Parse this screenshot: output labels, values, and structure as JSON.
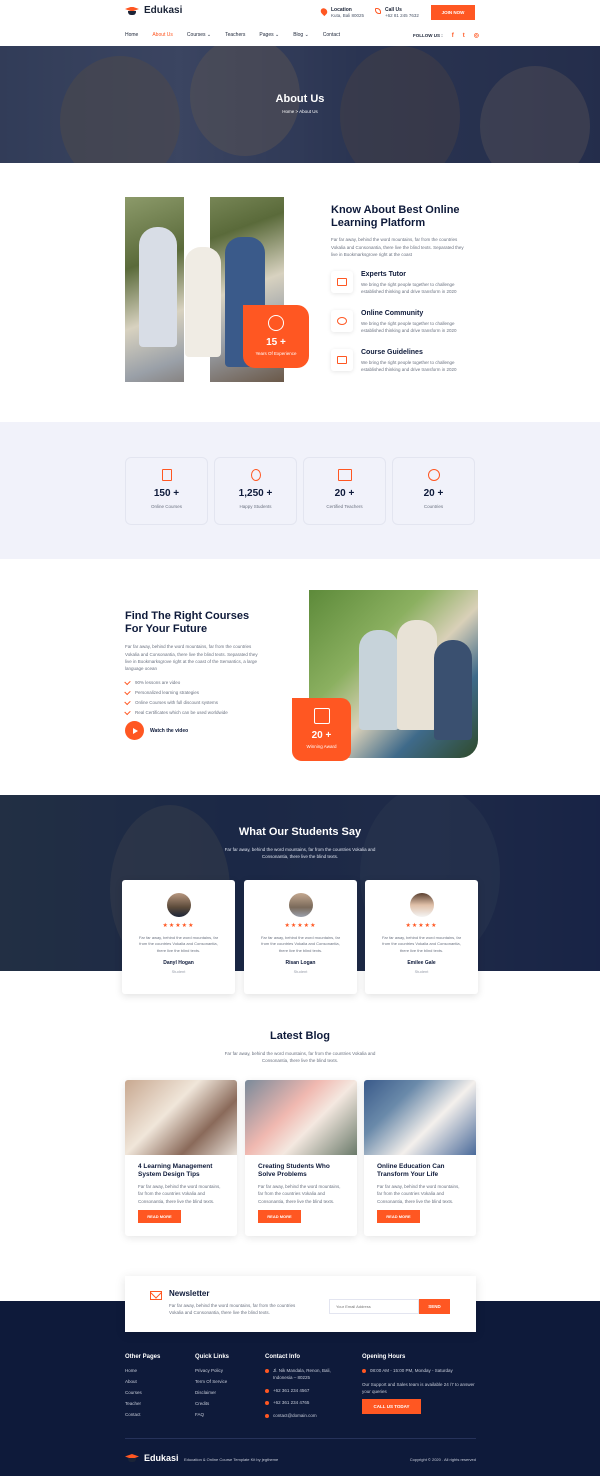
{
  "header": {
    "brand": "Edukasi",
    "location_label": "Location",
    "location_value": "Kuta, Bali 80025",
    "call_label": "Call Us",
    "call_value": "+62 81 245 7632",
    "join_button": "JOIN NOW",
    "follow_label": "FOLLOW US :",
    "nav": [
      {
        "label": "Home"
      },
      {
        "label": "About Us"
      },
      {
        "label": "Courses ⌄"
      },
      {
        "label": "Teachers"
      },
      {
        "label": "Pages ⌄"
      },
      {
        "label": "Blog ⌄"
      },
      {
        "label": "Contact"
      }
    ],
    "social_icons": [
      "facebook-icon",
      "twitter-icon",
      "instagram-icon"
    ]
  },
  "hero": {
    "title": "About Us",
    "breadcrumb": "Home  >  About Us"
  },
  "about": {
    "badge_number": "15 +",
    "badge_label": "Years Of Experience",
    "title_line1": "Know About Best Online",
    "title_line2": "Learning Platform",
    "text": "Far far away, behind the word mountains, far from the countries Vokalia and Consonantia, there live the blind texts. Separated they live in Bookmarksgrove right at the coast",
    "features": [
      {
        "title": "Experts Tutor",
        "text": "We bring the right people together to challenge established thinking and drive transform in 2020"
      },
      {
        "title": "Online Community",
        "text": "We bring the right people together to challenge established thinking and drive transform in 2020"
      },
      {
        "title": "Course Guidelines",
        "text": "We bring the right people together to challenge established thinking and drive transform in 2020"
      }
    ]
  },
  "stats": [
    {
      "number": "150 +",
      "label": "Online Courses",
      "icon": "book-icon"
    },
    {
      "number": "1,250 +",
      "label": "Happy Students",
      "icon": "student-icon"
    },
    {
      "number": "20 +",
      "label": "Certified Teachers",
      "icon": "teachers-icon"
    },
    {
      "number": "20 +",
      "label": "Countries",
      "icon": "globe-icon"
    }
  ],
  "courses": {
    "title_line1": "Find The Right Courses",
    "title_line2": "For Your Future",
    "text": "Far far away, behind the word mountains, far from the countries Vokalia and Consonantia, there live the blind texts. Separated they live in Bookmarksgrove right at the coast of the Semantics, a large language ocean",
    "checks": [
      "90% lessons are video",
      "Personalized learning strategies",
      "Online Courses with full discount systems",
      "Real Certificates which can be used worldwide"
    ],
    "video_label": "Watch the video",
    "badge_number": "20 +",
    "badge_label": "Winning Award"
  },
  "testimonials": {
    "title": "What Our Students Say",
    "text": "Far far away, behind the word mountains, far from the countries Vokalia and Consonantia, there live the blind texts.",
    "items": [
      {
        "stars": "★★★★★",
        "quote": "Far far away, behind the word mountains, far from the countries Vokalia and Consonantia, there live the blind texts.",
        "name": "Danyl Hogan",
        "role": "Student"
      },
      {
        "stars": "★★★★★",
        "quote": "Far far away, behind the word mountains, far from the countries Vokalia and Consonantia, there live the blind texts.",
        "name": "Risan Logan",
        "role": "Student"
      },
      {
        "stars": "★★★★★",
        "quote": "Far far away, behind the word mountains, far from the countries Vokalia and Consonantia, there live the blind texts.",
        "name": "Emilee Gale",
        "role": "Student"
      }
    ]
  },
  "blog": {
    "title": "Latest Blog",
    "text": "Far far away, behind the word mountains, far from the countries Vokalia and Consonantia, there live the blind texts.",
    "posts": [
      {
        "title": "4 Learning Management System Design Tips",
        "text": "Far far away, behind the word mountains, far from the countries Vokalia and Consonantia, there live the blind texts.",
        "button": "READ MORE"
      },
      {
        "title": "Creating Students Who Solve Problems",
        "text": "Far far away, behind the word mountains, far from the countries Vokalia and Consonantia, there live the blind texts.",
        "button": "READ MORE"
      },
      {
        "title": "Online Education Can Transform Your Life",
        "text": "Far far away, behind the word mountains, far from the countries Vokalia and Consonantia, there live the blind texts.",
        "button": "READ MORE"
      }
    ]
  },
  "newsletter": {
    "title": "Newsletter",
    "text": "Far far away, behind the word mountains, far from the countries Vokalia and Consonantia, there live the blind texts.",
    "placeholder": "Your Email Address",
    "button": "SEND"
  },
  "footer": {
    "other_pages_title": "Other Pages",
    "other_pages": [
      "Home",
      "About",
      "Courses",
      "Teacher",
      "Contact"
    ],
    "quick_links_title": "Quick Links",
    "quick_links": [
      "Privacy Policy",
      "Term Of Service",
      "Disclaimer",
      "Credits",
      "FAQ"
    ],
    "contact_title": "Contact Info",
    "contact": [
      "Jl. Nik Mandala, Renon, Bali, Indonesia – 80225",
      "+62 361 234 4567",
      "+62 361 234 4765",
      "contact@domain.com"
    ],
    "hours_title": "Opening Hours",
    "hours": "08:00 AM - 15:00 PM, Monday - Saturday",
    "hours_text": "Our Support and Sales team is available 24 /7 to answer your queries",
    "call_button": "CALL US TODAY",
    "brand": "Edukasi",
    "tagline": "Education & Online Course Template Kit by jegtheme",
    "copyright": "Copyright © 2020 . All rights reserved"
  },
  "colors": {
    "accent": "#ff5722",
    "navy": "#0e1a3a",
    "light_bg": "#f1f2fa"
  }
}
